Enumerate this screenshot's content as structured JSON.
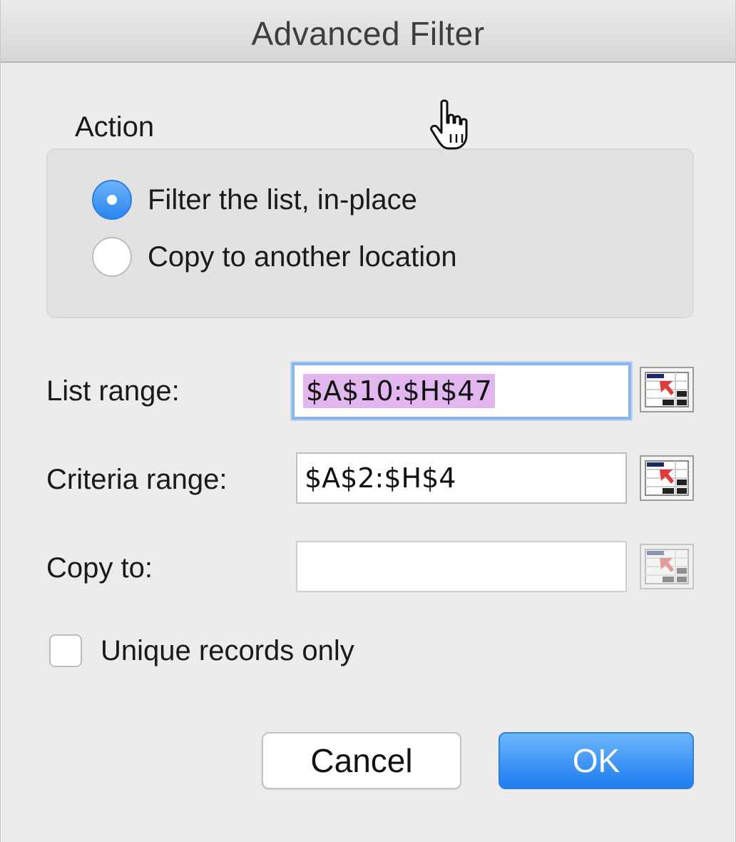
{
  "window": {
    "title": "Advanced Filter"
  },
  "action": {
    "label": "Action",
    "options": [
      {
        "label": "Filter the list, in-place",
        "checked": true
      },
      {
        "label": "Copy to another location",
        "checked": false
      }
    ]
  },
  "fields": {
    "list_range": {
      "label": "List range:",
      "value": "$A$10:$H$47",
      "focused": true
    },
    "criteria_range": {
      "label": "Criteria range:",
      "value": "$A$2:$H$4"
    },
    "copy_to": {
      "label": "Copy to:",
      "value": "",
      "enabled": false
    }
  },
  "unique": {
    "label": "Unique records only",
    "checked": false
  },
  "buttons": {
    "cancel": "Cancel",
    "ok": "OK"
  },
  "icons": {
    "range_picker": "collapse-dialog-icon",
    "cursor": "hand-pointer-icon"
  },
  "colors": {
    "accent": "#2c86f0",
    "selection": "#e2b6ee",
    "focus_ring": "#8ab7ec"
  }
}
